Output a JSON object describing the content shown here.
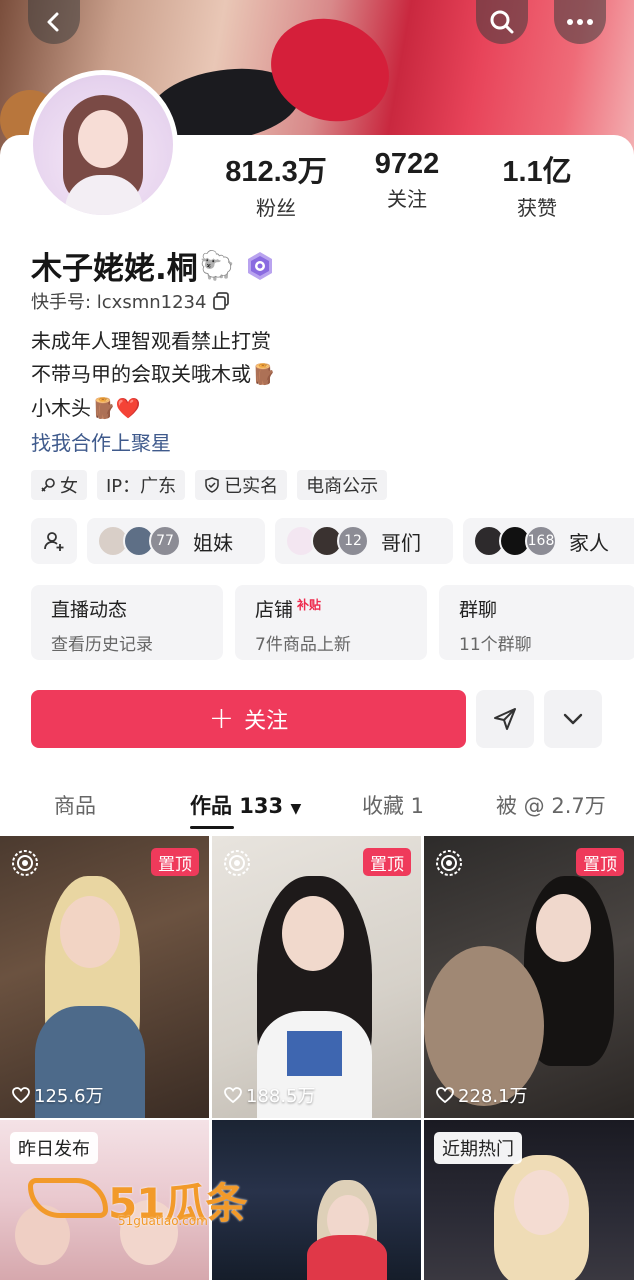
{
  "profile": {
    "name": "木子姥姥.桐",
    "name_emoji": "🐑",
    "uid": "快手号: lcxsmn1234",
    "bio": [
      "未成年人理智观看禁止打赏",
      "不带马甲的会取关哦木或🪵",
      "小木头🪵❤️"
    ],
    "bio_link": "找我合作上聚星"
  },
  "stats": [
    {
      "num": "812.3万",
      "label": "粉丝"
    },
    {
      "num": "9722",
      "label": "关注"
    },
    {
      "num": "1.1亿",
      "label": "获赞"
    }
  ],
  "tags": [
    "女",
    "IP：广东",
    "已实名",
    "电商公示"
  ],
  "relations": [
    {
      "count": "77",
      "label": "姐妹"
    },
    {
      "count": "12",
      "label": "哥们"
    },
    {
      "count": "168",
      "label": "家人"
    }
  ],
  "info_cards": [
    {
      "title": "直播动态",
      "sub": "查看历史记录",
      "badge": ""
    },
    {
      "title": "店铺",
      "sub": "7件商品上新",
      "badge": "补贴"
    },
    {
      "title": "群聊",
      "sub": "11个群聊",
      "badge": ""
    }
  ],
  "follow_label": "关注",
  "tabs": [
    "商品",
    "作品 133",
    "收藏 1",
    "被 @ 2.7万"
  ],
  "videos": [
    {
      "likes": "125.6万",
      "pin": "置顶",
      "badge": ""
    },
    {
      "likes": "188.5万",
      "pin": "置顶",
      "badge": ""
    },
    {
      "likes": "228.1万",
      "pin": "置顶",
      "badge": ""
    },
    {
      "likes": "",
      "pin": "",
      "badge": "昨日发布"
    },
    {
      "likes": "",
      "pin": "",
      "badge": ""
    },
    {
      "likes": "",
      "pin": "",
      "badge": "近期热门"
    }
  ],
  "watermark": {
    "text": "51瓜条",
    "url": "51guatiao.com"
  },
  "icons": [
    "back-icon",
    "search-icon",
    "more-icon",
    "copy-icon",
    "add-friend-icon",
    "send-icon",
    "chevron-down-icon",
    "live-icon",
    "heart-icon"
  ],
  "colors": {
    "accent": "#ef3a5b",
    "link": "#3f5a8c"
  }
}
